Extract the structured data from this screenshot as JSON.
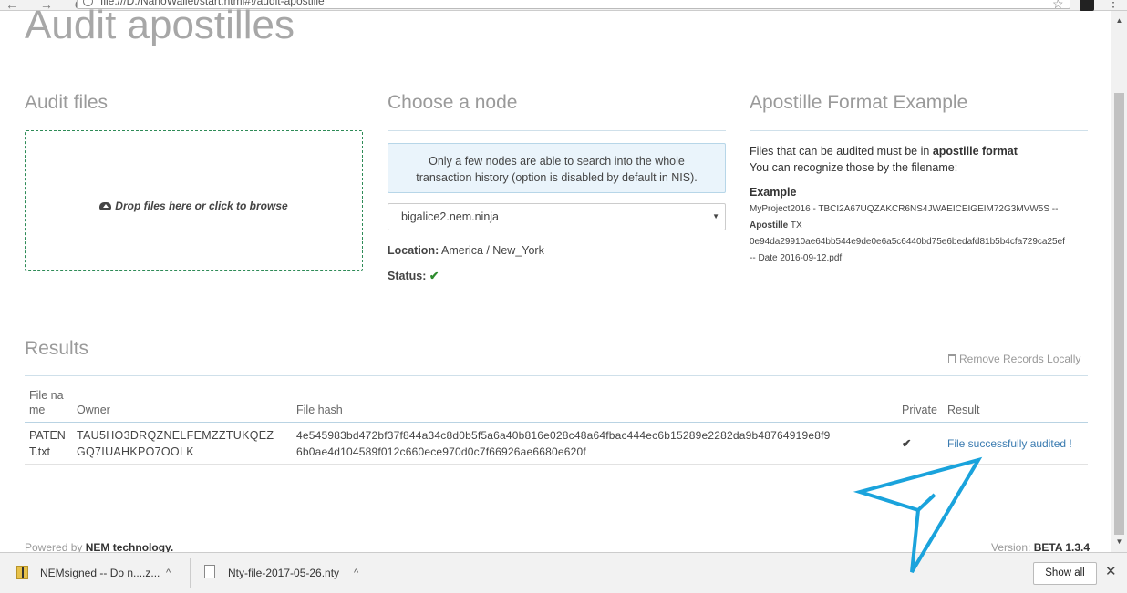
{
  "browser": {
    "nav": "← → C",
    "url": "file:///D:/NanoWallet/start.html#!/audit-apostille",
    "info_icon": "i"
  },
  "page": {
    "title": "Audit apostilles"
  },
  "audit_files": {
    "heading": "Audit files",
    "drop_label": "Drop files here or click to browse"
  },
  "node": {
    "heading": "Choose a node",
    "info_line1": "Only a few nodes are able to search into the whole",
    "info_line2": "transaction history (option is disabled by default in NIS).",
    "selected": "bigalice2.nem.ninja",
    "location_label": "Location:",
    "location_value": "America / New_York",
    "status_label": "Status:",
    "status_icon": "✔"
  },
  "format": {
    "heading": "Apostille Format Example",
    "line1_pre": "Files that can be audited must be in ",
    "line1_bold": "apostille format",
    "line2": "You can recognize those by the filename:",
    "example_label": "Example",
    "ex1": "MyProject2016 - TBCI2A67UQZAKCR6NS4JWAEICEIGEIM72G3MVW5S --",
    "ex2_bold": "Apostille",
    "ex2_rest": " TX",
    "ex3": "0e94da29910ae64bb544e9de0e6a5c6440bd75e6bedafd81b5b4cfa729ca25ef",
    "ex4": "-- Date 2016-09-12.pdf"
  },
  "results": {
    "heading": "Results",
    "remove_label": "Remove Records Locally",
    "columns": {
      "filename_1": "File na",
      "filename_2": "me",
      "owner": "Owner",
      "hash": "File hash",
      "private": "Private",
      "result": "Result"
    },
    "row": {
      "filename_1": "PATEN",
      "filename_2": "T.txt",
      "owner_1": "TAU5HO3DRQZNELFEMZZTUKQEZ",
      "owner_2": "GQ7IUAHKPO7OOLK",
      "hash_1": "4e545983bd472bf37f844a34c8d0b5f5a6a40b816e028c48a64fbac444ec6b15289e2282da9b48764919e8f9",
      "hash_2": "6b0ae4d104589f012c660ece970d0c7f66926ae6680e620f",
      "private_icon": "✔",
      "result": "File successfully audited !"
    }
  },
  "footer": {
    "powered_pre": "Powered by ",
    "powered_brand": "NEM technology.",
    "version_pre": "Version: ",
    "version_value": "BETA 1.3.4"
  },
  "downloads": {
    "item1": "NEMsigned -- Do n....z...",
    "item2": "Nty-file-2017-05-26.nty",
    "chevron": "^",
    "show_all": "Show all",
    "close": "✕"
  },
  "colors": {
    "accent": "#3a7bb0",
    "annotation": "#1aa3dc",
    "success": "#2e8b2e"
  }
}
